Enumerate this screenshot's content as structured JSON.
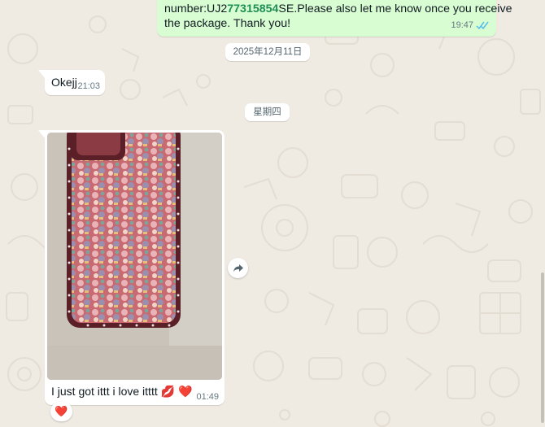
{
  "chat": {
    "outgoing": {
      "line1_prefix": "number:UJ2",
      "line1_tracking": "77315854",
      "line1_suffix": "SE.Please also let me know once you receive",
      "line2": "the package. Thank you!",
      "time": "19:47",
      "status_icon": "double-check-read-icon"
    },
    "date_chips": [
      "2025年12月11日",
      "星期四"
    ],
    "incoming_text": {
      "text": "Okejj",
      "time": "21:03"
    },
    "incoming_image": {
      "caption": "I just got ittt i love itttt",
      "caption_emojis": [
        "💋",
        "❤️"
      ],
      "time": "01:49",
      "image_icon": "phone-case-photo",
      "reaction": "❤️"
    },
    "forward_icon": "forward-arrow-icon"
  },
  "colors": {
    "wallpaper": "#efeae2",
    "outgoing_bubble": "#d9fdd3",
    "incoming_bubble": "#ffffff",
    "read_ticks": "#53bdeb",
    "tracking_highlight": "#1f8f55"
  }
}
